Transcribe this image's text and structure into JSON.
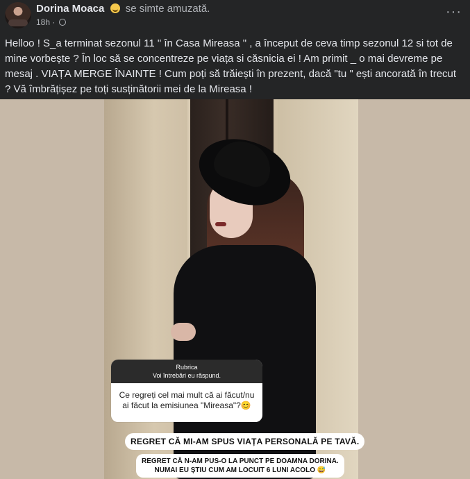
{
  "post": {
    "author": "Dorina Moaca",
    "feeling": "se simte amuzată.",
    "time": "18h ·",
    "more_label": "···",
    "text": "Helloo ! S_a terminat sezonul 11 \" în Casa Mireasa \" , a început de ceva timp sezonul 12 si tot de mine vorbește ? În loc să se concentreze pe viața si căsnicia ei ! Am primit _ o mai devreme pe mesaj . VIAȚA MERGE ÎNAINTE ! Cum poți să trăiești în prezent, dacă \"tu \" ești ancorată în trecut ? Vă îmbrățișez pe toți susținătorii mei de la Mireasa !"
  },
  "story": {
    "box_title": "Rubrica",
    "box_subtitle": "Voi întrebări eu răspund.",
    "question": "Ce regreți cel mai mult că ai făcut/nu ai făcut la emisiunea \"Mireasa\"?😊",
    "answer1": "REGRET CĂ MI-AM SPUS VIAȚA PERSONALĂ PE TAVĂ.",
    "answer2_line1": "REGRET CĂ N-AM PUS-O LA PUNCT PE DOAMNA DORINA.",
    "answer2_line2": "NUMAI EU ȘTIU CUM AM LOCUIT 6 LUNI ACOLO 😅"
  },
  "colors": {
    "background": "#242526",
    "text": "#e4e6eb",
    "secondary": "#b0b3b8"
  },
  "icons": [
    "avatar",
    "smile-emoji-icon",
    "globe-icon",
    "more-icon"
  ]
}
